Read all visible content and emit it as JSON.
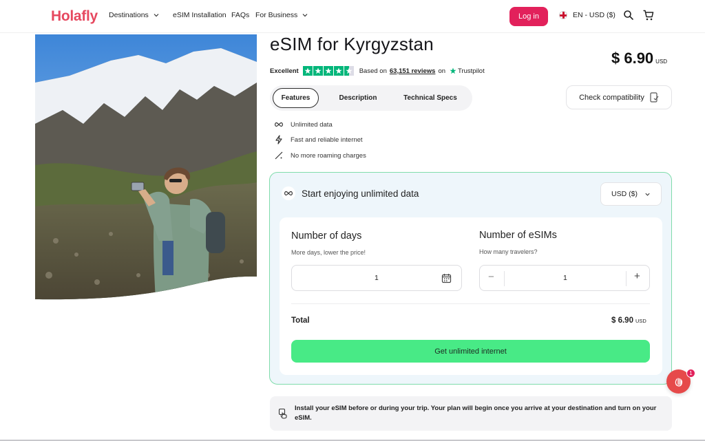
{
  "header": {
    "logo": "Holafly",
    "nav": {
      "destinations": "Destinations",
      "esim_installation": "eSIM Installation",
      "faqs": "FAQs",
      "for_business": "For Business"
    },
    "login_label": "Log in",
    "language": "EN - USD ($)",
    "icons": [
      "globe-flag-icon",
      "search-icon",
      "cart-icon"
    ]
  },
  "product": {
    "title": "eSIM for Kyrgyzstan",
    "price": "$ 6.90",
    "price_currency": "USD",
    "rating": {
      "label": "Excellent",
      "stars": 4.5,
      "based_on": "Based on",
      "reviews": "63,151 reviews",
      "on": "on",
      "provider": "Trustpilot"
    }
  },
  "tabs": {
    "features": "Features",
    "description": "Description",
    "technical_specs": "Technical Specs",
    "active": "Features"
  },
  "compatibility_label": "Check compatibility",
  "features": [
    {
      "icon": "infinity-icon",
      "label": "Unlimited data"
    },
    {
      "icon": "lightning-icon",
      "label": "Fast and reliable internet"
    },
    {
      "icon": "no-roaming-icon",
      "label": "No more roaming charges"
    }
  ],
  "plan": {
    "heading": "Start enjoying unlimited data",
    "currency": "USD ($)",
    "days": {
      "label": "Number of days",
      "hint": "More days, lower the price!",
      "value": "1"
    },
    "esims": {
      "label": "Number of eSIMs",
      "hint": "How many travelers?",
      "value": "1",
      "minus": "−",
      "plus": "+"
    },
    "total_label": "Total",
    "total_value": "$ 6.90",
    "total_currency": "USD",
    "cta": "Get unlimited internet"
  },
  "chat": {
    "badge": "1"
  },
  "note": "Install your eSIM before or during your trip. Your plan will begin once you arrive at your destination and turn on your eSIM.",
  "colors": {
    "brand": "#e6485f",
    "login": "#e2215b",
    "cta": "#48ea86",
    "plan_border": "#7fdcaa",
    "trustpilot": "#00b67a"
  }
}
